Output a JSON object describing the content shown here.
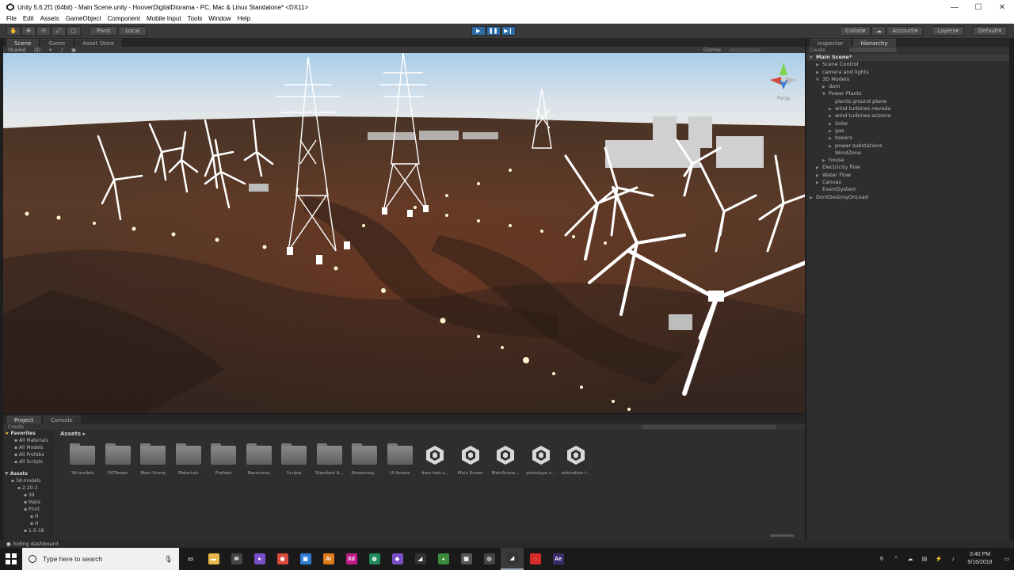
{
  "window": {
    "title": "Unity 5.6.2f1 (64bit) - Main Scene.unity - HooverDigitalDiorama - PC, Mac & Linux Standalone* <DX11>",
    "controls": [
      "—",
      "☐",
      "✕"
    ]
  },
  "menu": [
    "File",
    "Edit",
    "Assets",
    "GameObject",
    "Component",
    "Mobile Input",
    "Tools",
    "Window",
    "Help"
  ],
  "toolbar": {
    "pivot": "Pivot",
    "local": "Local",
    "collab": "Collab",
    "account": "Account",
    "layers": "Layers",
    "layout": "Default"
  },
  "scene_tabs": [
    "Scene",
    "Game",
    "Asset Store"
  ],
  "scene_sub": {
    "shading": "Shaded",
    "mode": "2D",
    "gizmos": "Gizmos"
  },
  "gizmo_label": "Persp",
  "right_tabs": [
    "Inspector",
    "Hierarchy"
  ],
  "hierarchy": {
    "create": "Create",
    "search": "All",
    "items": [
      {
        "label": "Main Scene*",
        "depth": 0,
        "arrow": "▼",
        "scene": true
      },
      {
        "label": "Scene Control",
        "depth": 1,
        "arrow": "▶"
      },
      {
        "label": "camera and lights",
        "depth": 1,
        "arrow": "▶"
      },
      {
        "label": "3D Models",
        "depth": 1,
        "arrow": "▼"
      },
      {
        "label": "dam",
        "depth": 2,
        "arrow": "▶"
      },
      {
        "label": "Power Plants",
        "depth": 2,
        "arrow": "▼"
      },
      {
        "label": "plants ground plane",
        "depth": 3,
        "arrow": ""
      },
      {
        "label": "wind turbines nevada",
        "depth": 3,
        "arrow": "▶"
      },
      {
        "label": "wind turbines arizona",
        "depth": 3,
        "arrow": "▶"
      },
      {
        "label": "Solar",
        "depth": 3,
        "arrow": "▶"
      },
      {
        "label": "gas",
        "depth": 3,
        "arrow": "▶"
      },
      {
        "label": "towers",
        "depth": 3,
        "arrow": "▶"
      },
      {
        "label": "power substations",
        "depth": 3,
        "arrow": "▶"
      },
      {
        "label": "WindZone",
        "depth": 3,
        "arrow": ""
      },
      {
        "label": "house",
        "depth": 2,
        "arrow": "▶"
      },
      {
        "label": "Electricity flow",
        "depth": 1,
        "arrow": "▶"
      },
      {
        "label": "Water Flow",
        "depth": 1,
        "arrow": "▶"
      },
      {
        "label": "Canvas",
        "depth": 1,
        "arrow": "▶"
      },
      {
        "label": "EventSystem",
        "depth": 1,
        "arrow": ""
      },
      {
        "label": "DontDestroyOnLoad",
        "depth": 0,
        "arrow": "▶",
        "scene": false
      }
    ]
  },
  "bottom_tabs": [
    "Project",
    "Console"
  ],
  "project": {
    "create": "Create",
    "breadcrumb": "Assets",
    "favorites_header": "Favorites",
    "favorites": [
      "All Materials",
      "All Models",
      "All Prefabs",
      "All Scripts"
    ],
    "assets_header": "Assets",
    "tree": [
      "3d-models",
      "2-20-2",
      "3d",
      "Mate",
      "Print",
      "H",
      "H",
      "1-5-18"
    ],
    "assets": [
      {
        "name": "3d-models",
        "kind": "folder"
      },
      {
        "name": "DOTween",
        "kind": "folder"
      },
      {
        "name": "Main Scene",
        "kind": "folder"
      },
      {
        "name": "Materials",
        "kind": "folder"
      },
      {
        "name": "Prefabs",
        "kind": "folder"
      },
      {
        "name": "Resources",
        "kind": "folder"
      },
      {
        "name": "Scripts",
        "kind": "folder"
      },
      {
        "name": "Standard A...",
        "kind": "folder"
      },
      {
        "name": "Streaming...",
        "kind": "folder"
      },
      {
        "name": "UI Assets",
        "kind": "folder"
      },
      {
        "name": "dam test s...",
        "kind": "unity"
      },
      {
        "name": "Main Scene",
        "kind": "unity"
      },
      {
        "name": "MainScene...",
        "kind": "unity"
      },
      {
        "name": "prototype s...",
        "kind": "unity"
      },
      {
        "name": "animation t...",
        "kind": "unity"
      }
    ]
  },
  "status": "hiding dashboard",
  "taskbar": {
    "search_placeholder": "Type here to search",
    "apps": [
      {
        "icon": "task-view-icon",
        "color": "#1a1a1a",
        "glyph": "▭"
      },
      {
        "icon": "file-explorer-icon",
        "color": "#e8b84a",
        "glyph": "▬"
      },
      {
        "icon": "mail-icon",
        "color": "#444444",
        "glyph": "✉"
      },
      {
        "icon": "purple-app-icon",
        "color": "#7b4fc9",
        "glyph": "●"
      },
      {
        "icon": "chrome-icon",
        "color": "#d94a3a",
        "glyph": "◉"
      },
      {
        "icon": "blue-app-icon",
        "color": "#2d7dd2",
        "glyph": "▣"
      },
      {
        "icon": "illustrator-icon",
        "color": "#e07b1a",
        "glyph": "Ai"
      },
      {
        "icon": "xd-icon",
        "color": "#c01a8a",
        "glyph": "Xd"
      },
      {
        "icon": "green-app-icon",
        "color": "#1f8a5c",
        "glyph": "◍"
      },
      {
        "icon": "visual-studio-icon",
        "color": "#7a4fc7",
        "glyph": "◆"
      },
      {
        "icon": "unity-hub-icon",
        "color": "#333333",
        "glyph": "◢"
      },
      {
        "icon": "git-icon",
        "color": "#3c8a3c",
        "glyph": "◕"
      },
      {
        "icon": "white-app-icon",
        "color": "#555555",
        "glyph": "▦"
      },
      {
        "icon": "unity-icon-2",
        "color": "#444444",
        "glyph": "◎"
      },
      {
        "icon": "unity-icon-active",
        "color": "#333333",
        "glyph": "◢",
        "active": true
      },
      {
        "icon": "red-app-icon",
        "color": "#d62a2a",
        "glyph": "◌"
      },
      {
        "icon": "after-effects-icon",
        "color": "#3b2b6b",
        "glyph": "Ae"
      }
    ],
    "tray": [
      "⚲",
      "⌃",
      "☁",
      "▤",
      "⚡",
      "♪"
    ],
    "time": "3:40 PM",
    "date": "9/16/2018"
  }
}
